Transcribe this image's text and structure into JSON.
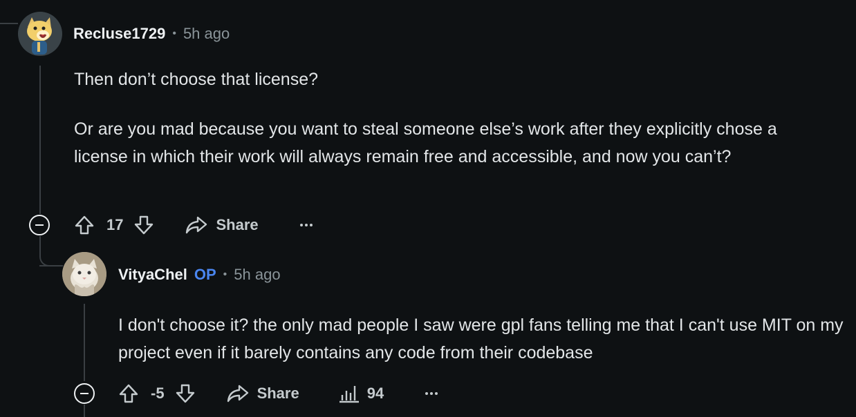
{
  "comments": [
    {
      "username": "Recluse1729",
      "separator": "•",
      "time": "5h ago",
      "paragraphs": [
        "Then don’t choose that license?",
        "Or are you mad because you want to steal someone else’s work after they explicitly chose a license in which their work will always remain free and accessible, and now you can’t?"
      ],
      "score": "17",
      "share_label": "Share",
      "more_icon": "ellipsis-icon"
    },
    {
      "username": "VityaChel",
      "op_badge": "OP",
      "separator": "•",
      "time": "5h ago",
      "paragraphs": [
        "I don't choose it? the only mad people I saw were gpl fans telling me that I can't use MIT on my project even if it barely contains any code from their codebase"
      ],
      "score": "-5",
      "share_label": "Share",
      "views": "94",
      "more_icon": "ellipsis-icon"
    }
  ],
  "colors": {
    "background": "#0e1113",
    "op_badge": "#4a86f0",
    "thread_line": "#3a3f43"
  }
}
